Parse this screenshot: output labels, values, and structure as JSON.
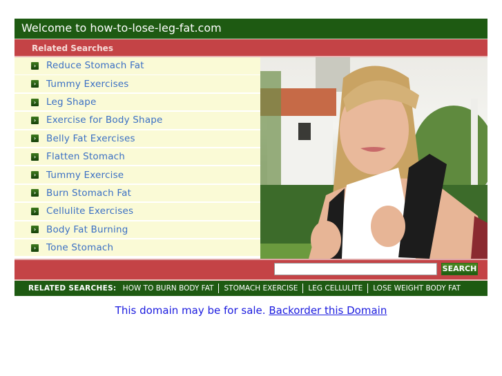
{
  "header": {
    "title": "Welcome to how-to-lose-leg-fat.com"
  },
  "related": {
    "heading": "Related Searches",
    "items": [
      {
        "label": "Reduce Stomach Fat",
        "icon": "arrow-right-icon"
      },
      {
        "label": "Tummy Exercises",
        "icon": "arrow-right-icon"
      },
      {
        "label": "Leg Shape",
        "icon": "arrow-right-icon"
      },
      {
        "label": "Exercise for Body Shape",
        "icon": "arrow-right-icon"
      },
      {
        "label": "Belly Fat Exercises",
        "icon": "arrow-right-icon"
      },
      {
        "label": "Flatten Stomach",
        "icon": "arrow-right-icon"
      },
      {
        "label": "Tummy Exercise",
        "icon": "arrow-right-icon"
      },
      {
        "label": "Burn Stomach Fat",
        "icon": "arrow-right-icon"
      },
      {
        "label": "Cellulite Exercises",
        "icon": "arrow-right-icon"
      },
      {
        "label": "Body Fat Burning",
        "icon": "arrow-right-icon"
      },
      {
        "label": "Tone Stomach",
        "icon": "arrow-right-icon"
      }
    ]
  },
  "photo": {
    "description": "Smiling blonde woman with backpack in front of campus building"
  },
  "search": {
    "value": "",
    "placeholder": "",
    "button_label": "SEARCH"
  },
  "bottom": {
    "label": "RELATED SEARCHES:",
    "links": [
      "HOW TO BURN BODY FAT",
      "STOMACH EXERCISE",
      "LEG CELLULITE",
      "LOSE WEIGHT BODY FAT"
    ]
  },
  "sale": {
    "text": "This domain may be for sale.",
    "link": "Backorder this Domain"
  },
  "colors": {
    "green": "#1e5a12",
    "red": "#c44346",
    "list_bg": "#fafad6",
    "link": "#3a6fc4",
    "sale": "#1a1adf"
  }
}
